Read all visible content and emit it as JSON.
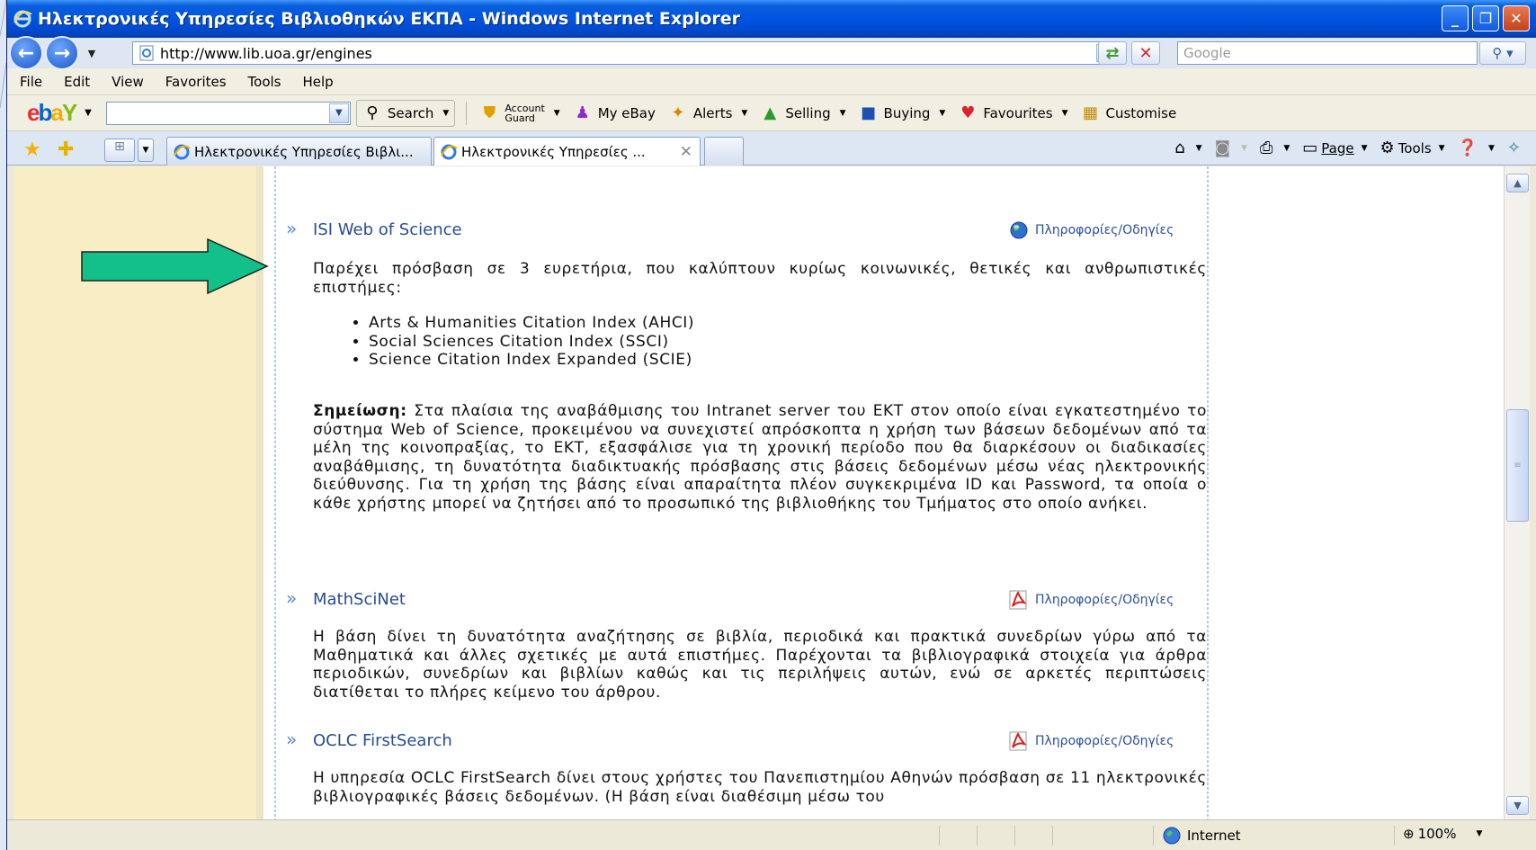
{
  "window": {
    "title": "Ηλεκτρονικές Υπηρεσίες Βιβλιοθηκών ΕΚΠΑ - Windows Internet Explorer",
    "minimize": "_",
    "restore": "❐",
    "close": "✕"
  },
  "address_bar": {
    "url": "http://www.lib.uoa.gr/engines",
    "search_placeholder": "Google"
  },
  "menu": [
    "File",
    "Edit",
    "View",
    "Favorites",
    "Tools",
    "Help"
  ],
  "ebay_toolbar": {
    "logo": [
      "e",
      "b",
      "a",
      "Y"
    ],
    "search_label": "Search",
    "account_guard": [
      "Account",
      "Guard"
    ],
    "my_ebay": "My eBay",
    "alerts": "Alerts",
    "selling": "Selling",
    "buying": "Buying",
    "favourites": "Favourites",
    "customise": "Customise"
  },
  "tabs": [
    {
      "label": "Ηλεκτρονικές Υπηρεσίες Βιβλι..."
    },
    {
      "label": "Ηλεκτρονικές Υπηρεσίες ..."
    }
  ],
  "command_bar": {
    "page": "Page",
    "tools": "Tools"
  },
  "content": {
    "info_label": "Πληροφορίες/Οδηγίες",
    "sections": [
      {
        "title": "ISI Web of Science",
        "intro": "Παρέχει πρόσβαση σε 3 ευρετήρια, που καλύπτουν κυρίως κοινωνικές, θετικές και ανθρωπιστικές επιστήμες:",
        "items": [
          "Arts & Humanities Citation Index (AHCI)",
          "Social Sciences Citation Index (SSCI)",
          "Science Citation Index Expanded (SCIE)"
        ],
        "note_label": "Σημείωση:",
        "note": "Στα πλαίσια της αναβάθμισης του Intranet server του ΕΚΤ στον οποίο είναι εγκατεστημένο το σύστημα Web of Science, προκειμένου να συνεχιστεί απρόσκοπτα η χρήση  των βάσεων δεδομένων από τα μέλη της κοινοπραξίας, το ΕΚΤ, εξασφάλισε για τη χρονική περίοδο που θα διαρκέσουν οι διαδικασίες αναβάθμισης, τη δυνατότητα διαδικτυακής πρόσβασης στις βάσεις δεδομένων μέσω νέας ηλεκτρονικής διεύθυνσης. Για τη χρήση της βάσης είναι απαραίτητα πλέον συγκεκριμένα ID και Password, τα οποία ο κάθε χρήστης μπορεί να ζητήσει από το προσωπικό της βιβλιοθήκης του Τμήματος στο οποίο ανήκει."
      },
      {
        "title": "MathSciNet",
        "desc": "Η βάση δίνει τη δυνατότητα αναζήτησης σε βιβλία, περιοδικά και πρακτικά συνεδρίων γύρω από τα Μαθηματικά και άλλες σχετικές με αυτά επιστήμες. Παρέχονται τα βιβλιογραφικά στοιχεία για άρθρα περιοδικών, συνεδρίων και βιβλίων καθώς και τις περιλήψεις αυτών, ενώ σε αρκετές περιπτώσεις διατίθεται το πλήρες κείμενο του άρθρου."
      },
      {
        "title": "OCLC FirstSearch",
        "desc": "Η υπηρεσία OCLC FirstSearch δίνει στους χρήστες του Πανεπιστημίου Αθηνών πρόσβαση σε 11 ηλεκτρονικές βιβλιογραφικές βάσεις δεδομένων. (Η βάση είναι διαθέσιμη μέσω του"
      }
    ]
  },
  "status_bar": {
    "zone": "Internet",
    "zoom": "100%"
  },
  "colors": {
    "titlebar": "#0054e3",
    "link": "#294c93",
    "sidebar": "#f9edc5",
    "arrow_fill": "#12c08a"
  }
}
